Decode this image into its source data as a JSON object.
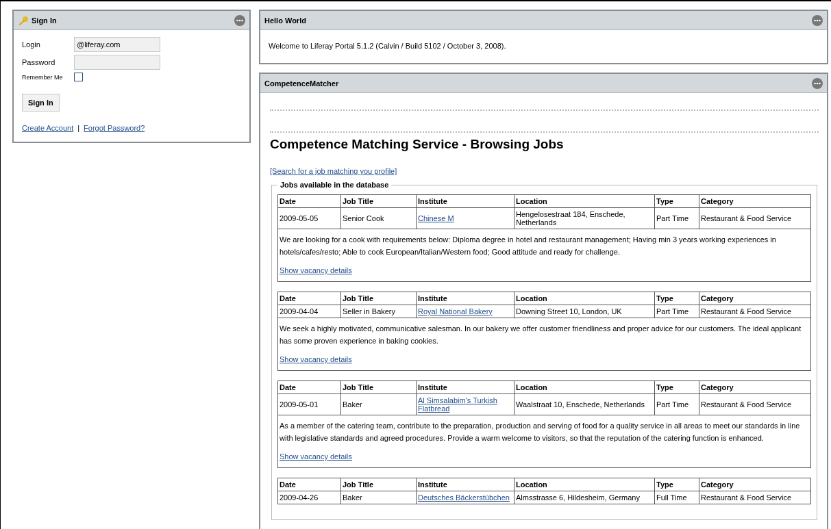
{
  "sign_in": {
    "title": "Sign In",
    "login_label": "Login",
    "login_value": "@liferay.com",
    "password_label": "Password",
    "remember_label": "Remember Me",
    "remember_checked": false,
    "button": "Sign In",
    "links": [
      "Create Account",
      "Forgot Password?"
    ],
    "separator": "|"
  },
  "hello_world": {
    "title": "Hello World",
    "text": "Welcome to Liferay Portal 5.1.2 (Calvin / Build 5102 / October 3, 2008)."
  },
  "matcher": {
    "title": "CompetenceMatcher",
    "heading": "Competence Matching Service - Browsing Jobs",
    "search_link": "[Search for a job matching you profile]",
    "legend": "Jobs available in the database",
    "jobs": [
      {
        "columns": [
          "Date",
          "Job Title",
          "Institute",
          "Location",
          "Type",
          "Category"
        ],
        "date": "2009-05-05",
        "title": "Senior Cook",
        "institute": "Chinese M",
        "location": "Hengelosestraat 184, Enschede, Netherlands",
        "type": "Part Time",
        "category": "Restaurant & Food Service",
        "description": "We are looking for a cook with requirements below: Diploma degree in hotel and restaurant management; Having min 3 years working experiences in hotels/cafes/resto; Able to cook European/Italian/Western food; Good attitude and ready for challenge.",
        "link": "Show vacancy details"
      },
      {
        "columns": [
          "Date",
          "Job Title",
          "Institute",
          "Location",
          "Type",
          "Category"
        ],
        "date": "2009-04-04",
        "title": "Seller in Bakery",
        "institute": "Royal National Bakery",
        "location": "Downing Street 10, London, UK",
        "type": "Part Time",
        "category": "Restaurant & Food Service",
        "description": "We seek a highly motivated, communicative salesman. In our bakery we offer customer friendliness and proper advice for our customers. The ideal applicant has some proven experience in baking cookies.",
        "link": "Show vacancy details"
      },
      {
        "columns": [
          "Date",
          "Job Title",
          "Institute",
          "Location",
          "Type",
          "Category"
        ],
        "date": "2009-05-01",
        "title": "Baker",
        "institute": "Al Simsalabim's Turkish Flatbread",
        "location": "Waalstraat 10, Enschede, Netherlands",
        "type": "Part Time",
        "category": "Restaurant & Food Service",
        "description": "As a member of the catering team, contribute to the preparation, production and serving of food for a quality service in all areas to meet our standards in line with legislative standards and agreed procedures. Provide a warm welcome to visitors, so that the reputation of the catering function is enhanced.",
        "link": "Show vacancy details"
      },
      {
        "columns": [
          "Date",
          "Job Title",
          "Institute",
          "Location",
          "Type",
          "Category"
        ],
        "date": "2009-04-26",
        "title": "Baker",
        "institute": "Deutsches Bäckerstübchen",
        "location": "Almsstrasse 6, Hildesheim, Germany",
        "type": "Full Time",
        "category": "Restaurant & Food Service"
      }
    ]
  }
}
